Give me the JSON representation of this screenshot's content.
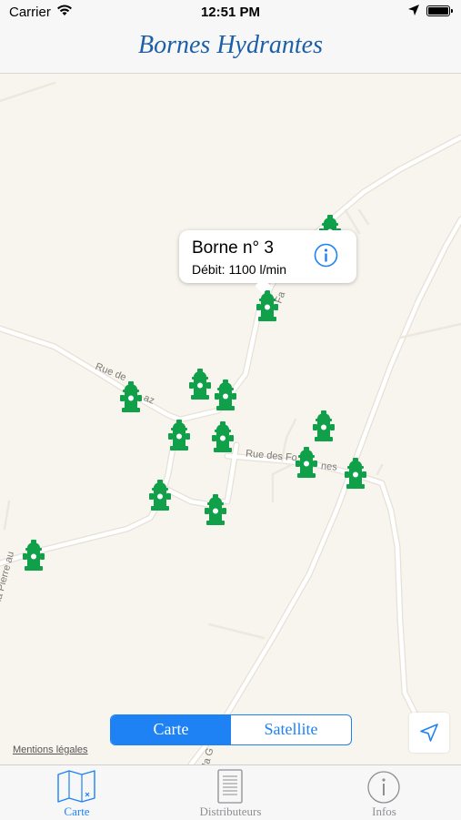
{
  "status_bar": {
    "carrier": "Carrier",
    "time": "12:51 PM",
    "icons": [
      "wifi-icon",
      "location-arrow-icon",
      "battery-icon"
    ]
  },
  "nav": {
    "title": "Bornes Hydrantes"
  },
  "map": {
    "streets": [
      "Rue de",
      "az",
      "Rue des Fo",
      "nes",
      "la Pierre au",
      "Fa",
      "la G"
    ],
    "callout": {
      "title": "Borne n° 3",
      "subtitle": "Débit: 1100 l/min",
      "icon": "info-icon"
    },
    "segmented": {
      "options": [
        "Carte",
        "Satellite"
      ],
      "selected": "Carte"
    },
    "legal": "Mentions légales",
    "locate_icon": "location-arrow-icon",
    "marker_color": "#0fa049"
  },
  "tabbar": {
    "tabs": [
      {
        "label": "Carte",
        "icon": "map-icon",
        "active": true
      },
      {
        "label": "Distributeurs",
        "icon": "list-icon",
        "active": false
      },
      {
        "label": "Infos",
        "icon": "info-icon",
        "active": false
      }
    ],
    "active_color": "#1e82f4",
    "inactive_color": "#8e8e93"
  }
}
